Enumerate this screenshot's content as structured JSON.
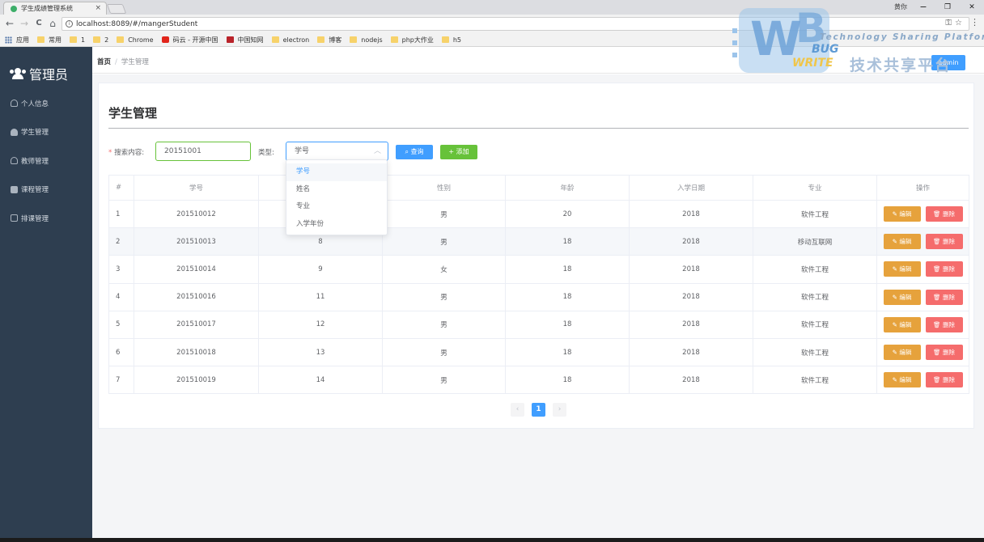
{
  "browser": {
    "tab_title": "学生成绩管理系统",
    "tab_close": "×",
    "window_user": "黄你",
    "min": "−",
    "max": "❐",
    "close": "✕",
    "back": "←",
    "forward": "→",
    "reload": "C",
    "home": "⌂",
    "url": "localhost:8089/#/mangerStudent",
    "url_icons": "⚿☆",
    "menu": "⋮",
    "bookmarks": [
      "应用",
      "常用",
      "1",
      "2",
      "Chrome",
      "码云 - 开源中国",
      "中国知网",
      "electron",
      "博客",
      "nodejs",
      "php大作业",
      "h5"
    ]
  },
  "sidebar": {
    "title": "管理员",
    "items": [
      {
        "label": "个人信息"
      },
      {
        "label": "学生管理"
      },
      {
        "label": "教师管理"
      },
      {
        "label": "课程管理"
      },
      {
        "label": "排课管理"
      }
    ]
  },
  "breadcrumb": {
    "home": "首页",
    "separator": "/",
    "current": "学生管理"
  },
  "header": {
    "admin": "admin"
  },
  "watermark": {
    "en": "Technology Sharing Platform",
    "cn": "技术共享平台",
    "logo_line1": "BUG",
    "logo_line2": "WRITE"
  },
  "page": {
    "title": "学生管理"
  },
  "search": {
    "label": "搜索内容:",
    "required_mark": "*",
    "value": "20151001",
    "type_label": "类型:",
    "type_value": "学号",
    "query_button": "查询",
    "add_button": "添加"
  },
  "type_options": [
    "学号",
    "姓名",
    "专业",
    "入学年份"
  ],
  "table": {
    "headers": [
      "#",
      "学号",
      "",
      "性别",
      "年龄",
      "入学日期",
      "专业",
      "操作"
    ],
    "edit_label": "编辑",
    "delete_label": "删除",
    "rows": [
      [
        "1",
        "201510012",
        "",
        "男",
        "20",
        "2018",
        "软件工程"
      ],
      [
        "2",
        "201510013",
        "8",
        "男",
        "18",
        "2018",
        "移动互联网"
      ],
      [
        "3",
        "201510014",
        "9",
        "女",
        "18",
        "2018",
        "软件工程"
      ],
      [
        "4",
        "201510016",
        "11",
        "男",
        "18",
        "2018",
        "软件工程"
      ],
      [
        "5",
        "201510017",
        "12",
        "男",
        "18",
        "2018",
        "软件工程"
      ],
      [
        "6",
        "201510018",
        "13",
        "男",
        "18",
        "2018",
        "软件工程"
      ],
      [
        "7",
        "201510019",
        "14",
        "男",
        "18",
        "2018",
        "软件工程"
      ]
    ]
  },
  "pagination": {
    "prev": "‹",
    "current": "1",
    "next": "›"
  }
}
